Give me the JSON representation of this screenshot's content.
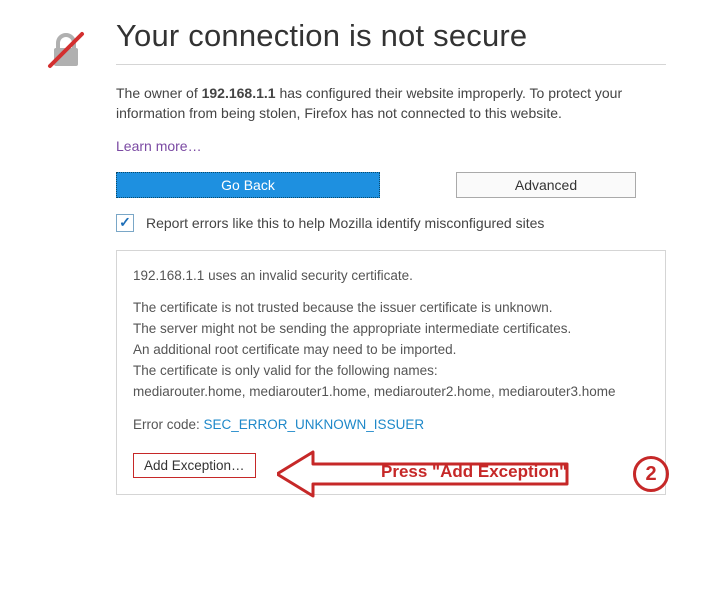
{
  "title": "Your connection is not secure",
  "description_prefix": "The owner of ",
  "description_host": "192.168.1.1",
  "description_suffix": " has configured their website improperly. To protect your information from being stolen, Firefox has not connected to this website.",
  "learn_more": "Learn more…",
  "buttons": {
    "go_back": "Go Back",
    "advanced": "Advanced"
  },
  "checkbox": {
    "checked_glyph": "✓",
    "label": "Report errors like this to help Mozilla identify misconfigured sites"
  },
  "details": {
    "line1": "192.168.1.1 uses an invalid security certificate.",
    "line2": "The certificate is not trusted because the issuer certificate is unknown.",
    "line3": "The server might not be sending the appropriate intermediate certificates.",
    "line4": "An additional root certificate may need to be imported.",
    "line5": "The certificate is only valid for the following names:",
    "line6": "  mediarouter.home, mediarouter1.home, mediarouter2.home, mediarouter3.home",
    "error_label": "Error code: ",
    "error_code": "SEC_ERROR_UNKNOWN_ISSUER",
    "add_exception": "Add Exception…"
  },
  "annotation": {
    "text": "Press \"Add Exception\"",
    "number": "2"
  }
}
